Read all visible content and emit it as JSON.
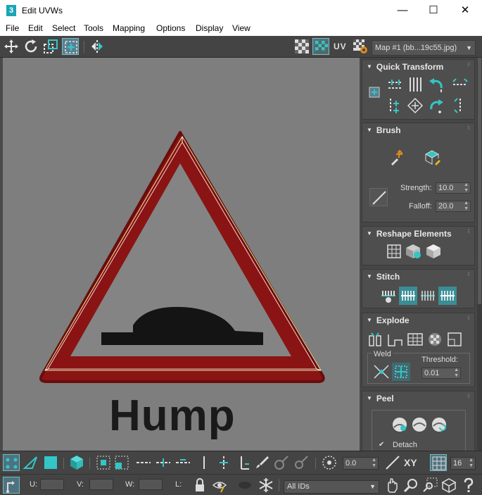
{
  "window": {
    "title": "Edit UVWs",
    "app_icon": "3",
    "minimize": "—",
    "maximize": "☐",
    "close": "✕"
  },
  "menu": [
    "File",
    "Edit",
    "Select",
    "Tools",
    "Mapping",
    "Options",
    "Display",
    "View"
  ],
  "toolbar": {
    "uv_label": "UV",
    "map_select": "Map #1 (bb...19c55.jpg)"
  },
  "viewport": {
    "sign_text": "Hump"
  },
  "panel": {
    "quick_transform": {
      "title": "Quick Transform"
    },
    "brush": {
      "title": "Brush",
      "strength_label": "Strength:",
      "strength_value": "10.0",
      "falloff_label": "Falloff:",
      "falloff_value": "20.0"
    },
    "reshape": {
      "title": "Reshape Elements"
    },
    "stitch": {
      "title": "Stitch"
    },
    "explode": {
      "title": "Explode",
      "weld_label": "Weld",
      "threshold_label": "Threshold:",
      "threshold_value": "0.01"
    },
    "peel": {
      "title": "Peel",
      "detach_label": "Detach",
      "detach_checked": true
    }
  },
  "bottom": {
    "angle_value": "0.0",
    "xy_label": "XY",
    "grid_value": "16",
    "u_label": "U:",
    "v_label": "V:",
    "w_label": "W:",
    "l_label": "L:",
    "ids_select": "All IDs"
  },
  "colors": {
    "accent": "#34c6c6",
    "toolbar_bg": "#444444",
    "panel_bg": "#464646",
    "viewport_bg": "#7e7e7e",
    "sign_red": "#8a1414"
  }
}
